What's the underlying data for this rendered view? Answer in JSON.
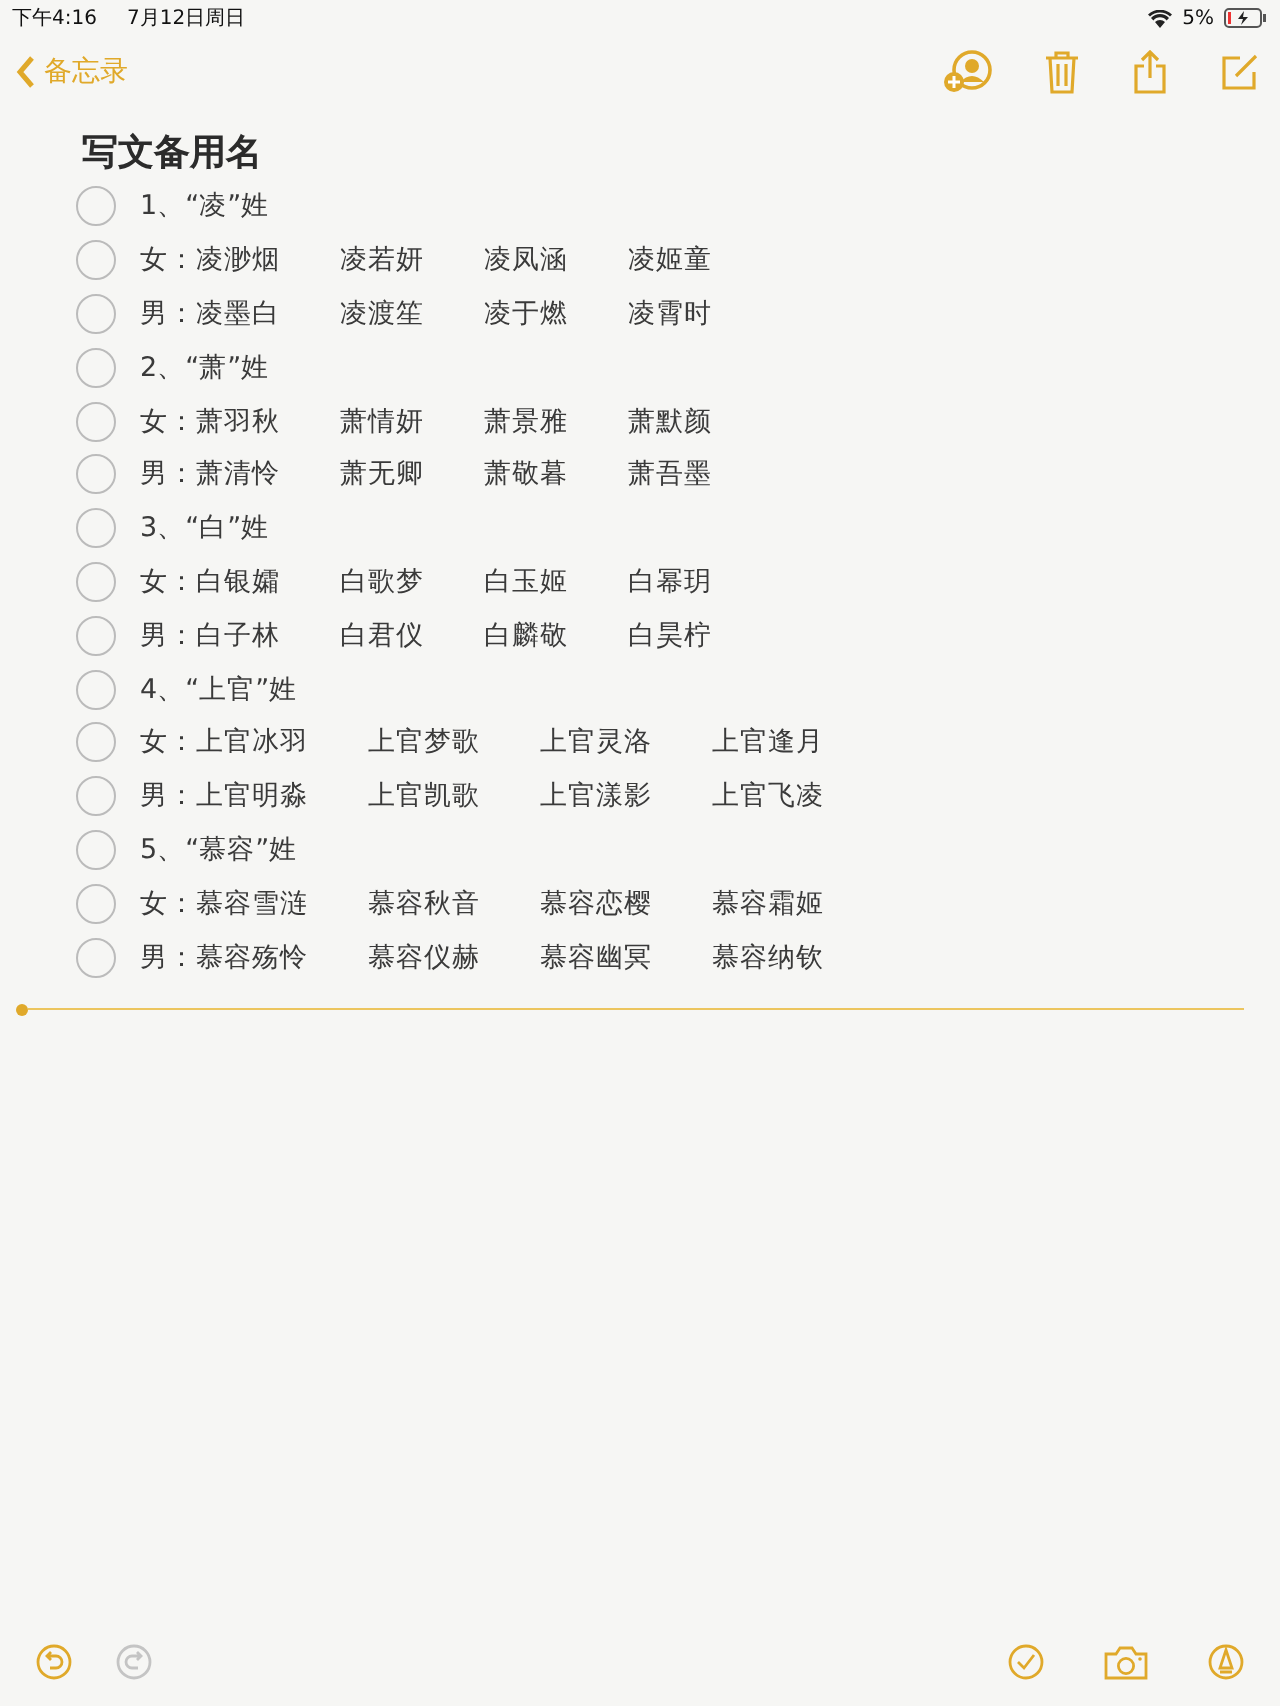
{
  "status_bar": {
    "time": "下午4:16",
    "date": "7月12日周日",
    "battery": "5%"
  },
  "nav": {
    "back": "备忘录"
  },
  "note": {
    "title": "写文备用名",
    "items": [
      {
        "kind": "heading",
        "checked": false,
        "cells": [
          "1、“凌”姓"
        ]
      },
      {
        "kind": "names",
        "checked": false,
        "cells": [
          "女：凌渺烟",
          "凌若妍",
          "凌凤涵",
          "凌姬童"
        ]
      },
      {
        "kind": "names",
        "checked": false,
        "cells": [
          "男：凌墨白",
          "凌渡笙",
          "凌于燃",
          "凌霄时"
        ]
      },
      {
        "kind": "heading",
        "checked": false,
        "cells": [
          "2、“萧”姓"
        ]
      },
      {
        "kind": "names",
        "checked": false,
        "cells": [
          "女：萧羽秋",
          "萧情妍",
          "萧景雅",
          "萧默颜"
        ]
      },
      {
        "kind": "names",
        "checked": false,
        "cells": [
          "男：萧清怜",
          "萧无卿",
          "萧敬暮",
          "萧吾墨"
        ]
      },
      {
        "kind": "heading",
        "checked": false,
        "cells": [
          "3、“白”姓"
        ]
      },
      {
        "kind": "names",
        "checked": false,
        "cells": [
          "女：白银孀",
          "白歌梦",
          "白玉姬",
          "白幂玥"
        ]
      },
      {
        "kind": "names",
        "checked": false,
        "cells": [
          "男：白子林",
          "白君仪",
          "白麟敬",
          "白昊柠"
        ]
      },
      {
        "kind": "heading",
        "checked": false,
        "cells": [
          "4、“上官”姓"
        ]
      },
      {
        "kind": "names",
        "checked": false,
        "cells": [
          "女：上官冰羽",
          "上官梦歌",
          "上官灵洛",
          "上官逢月"
        ]
      },
      {
        "kind": "names",
        "checked": false,
        "cells": [
          "男：上官明淼",
          "上官凯歌",
          "上官漾影",
          "上官飞凌"
        ]
      },
      {
        "kind": "heading",
        "checked": false,
        "cells": [
          "5、“慕容”姓"
        ]
      },
      {
        "kind": "names",
        "checked": false,
        "cells": [
          "女：慕容雪涟",
          "慕容秋音",
          "慕容恋樱",
          "慕容霜姬"
        ]
      },
      {
        "kind": "names",
        "checked": false,
        "cells": [
          "男：慕容殇怜",
          "慕容仪赫",
          "慕容幽冥",
          "慕容纳钦"
        ]
      }
    ]
  },
  "toolbar": {
    "undo": {
      "disabled": false
    },
    "redo": {
      "disabled": true
    }
  }
}
